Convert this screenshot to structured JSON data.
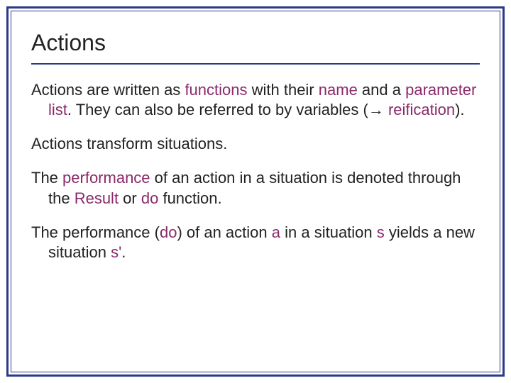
{
  "title": "Actions",
  "p1": {
    "t1": "Actions are written as ",
    "k1": "functions",
    "t2": " with their ",
    "k2": "name",
    "t3": " and a ",
    "k3": "parameter list",
    "t4": ". They can also be referred to by variables (",
    "arrow": "→",
    "t5": " ",
    "k4": "reification",
    "t6": ")."
  },
  "p2": {
    "t1": "Actions transform situations."
  },
  "p3": {
    "t1": "The ",
    "k1": "performance",
    "t2": " of an action in a situation is denoted through the ",
    "k2": "Result",
    "t3": " or ",
    "k3": "do",
    "t4": " function."
  },
  "p4": {
    "t1": "The performance (",
    "k1": "do",
    "t2": ") of an action ",
    "k2": "a",
    "t3": " in a situation ",
    "k3": "s",
    "t4": " yields a new situation ",
    "k4": "s'",
    "t5": "."
  }
}
